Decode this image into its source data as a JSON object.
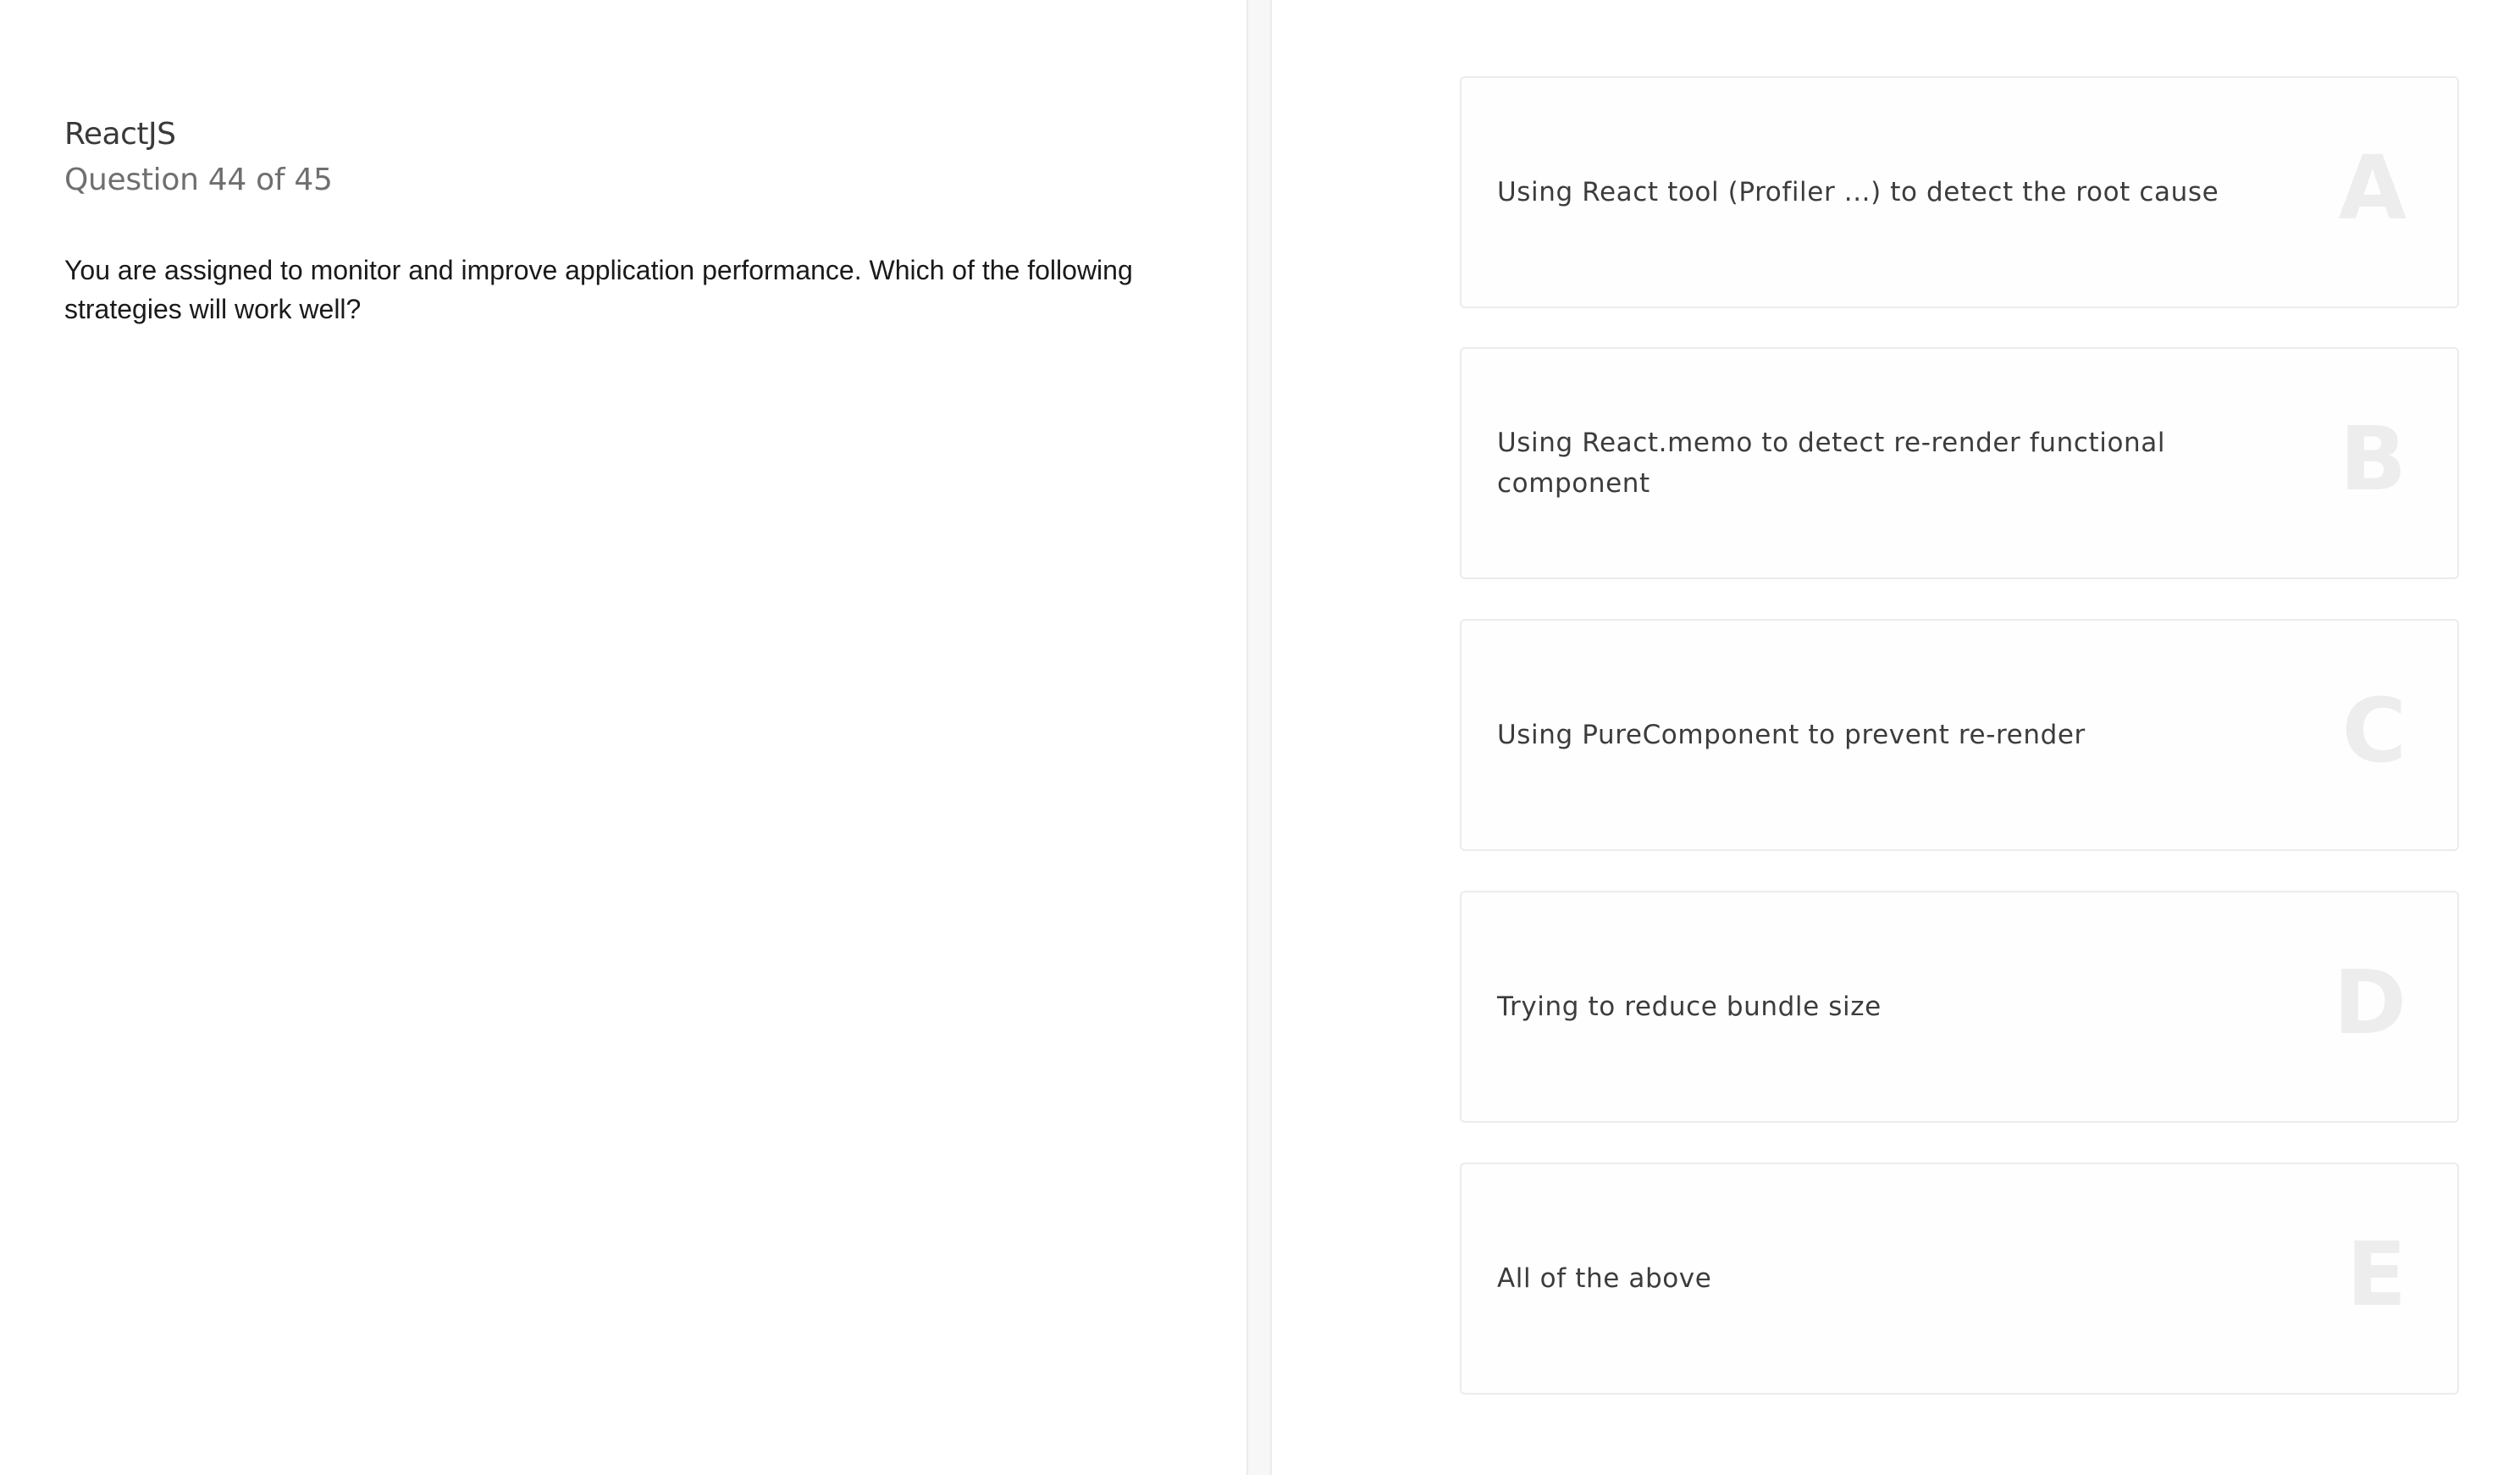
{
  "quiz": {
    "subject": "ReactJS",
    "progress": "Question 44 of 45",
    "question": "You are assigned to monitor and improve application performance. Which of the following strategies will work well?"
  },
  "options": [
    {
      "letter": "A",
      "text": "Using React tool (Profiler ...) to detect the root cause"
    },
    {
      "letter": "B",
      "text": "Using React.memo to detect re-render functional component"
    },
    {
      "letter": "C",
      "text": "Using PureComponent to prevent re-render"
    },
    {
      "letter": "D",
      "text": "Trying to reduce bundle size"
    },
    {
      "letter": "E",
      "text": "All of the above"
    }
  ]
}
